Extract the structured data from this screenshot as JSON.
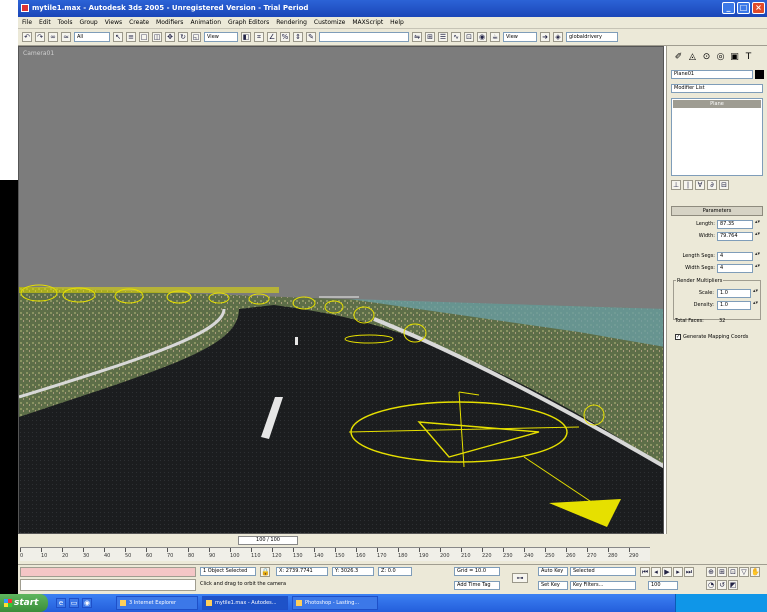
{
  "window": {
    "title": "mytile1.max - Autodesk 3ds 2005 - Unregistered Version - Trial Period"
  },
  "menubar": {
    "items": [
      "File",
      "Edit",
      "Tools",
      "Group",
      "Views",
      "Create",
      "Modifiers",
      "Animation",
      "Graph Editors",
      "Rendering",
      "Customize",
      "MAXScript",
      "Help"
    ]
  },
  "toolbar": {
    "selection_filter": "All",
    "ref_coord": "View",
    "named_sel": "",
    "view2": "View",
    "reactor": "globaldrivery"
  },
  "viewport": {
    "label": "Camera01"
  },
  "command_panel": {
    "object_name": "Plane01",
    "modifier_list": "Modifier List",
    "stack_item": "Plane",
    "rollout": "Parameters",
    "length_label": "Length:",
    "length_val": "87.35",
    "width_label": "Width:",
    "width_val": "79.764",
    "length_segs_label": "Length Segs:",
    "length_segs": "4",
    "width_segs_label": "Width Segs:",
    "width_segs": "4",
    "render_mult_label": "Render Multipliers",
    "scale_label": "Scale:",
    "scale_val": "1.0",
    "density_label": "Density:",
    "density_val": "1.0",
    "total_faces_label": "Total Faces:",
    "total_faces": "32",
    "gen_mapping_label": "Generate Mapping Coords"
  },
  "timeline": {
    "slider": "100 / 100",
    "ticks": [
      "0",
      "10",
      "20",
      "30",
      "40",
      "50",
      "60",
      "70",
      "80",
      "90",
      "100",
      "110",
      "120",
      "130",
      "140",
      "150",
      "160",
      "170",
      "180",
      "190",
      "200",
      "210",
      "220",
      "230",
      "240",
      "250",
      "260",
      "270",
      "280",
      "290"
    ]
  },
  "status": {
    "selected": "1 Object Selected",
    "prompt": "Click and drag to orbit the camera",
    "x": "X: 2739.7741",
    "y": "Y: 3026.3",
    "z": "Z: 0.0",
    "grid": "Grid = 10.0",
    "add_tag": "Add Time Tag",
    "autokey": "Auto Key",
    "setkey": "Set Key",
    "key_mode": "Selected",
    "key_filters": "Key Filters...",
    "frame": "100"
  },
  "taskbar": {
    "start": "start",
    "tasks": [
      "3 Internet Explorer",
      "mytile1.max - Autodes...",
      "Photoshop - Lasting..."
    ]
  }
}
